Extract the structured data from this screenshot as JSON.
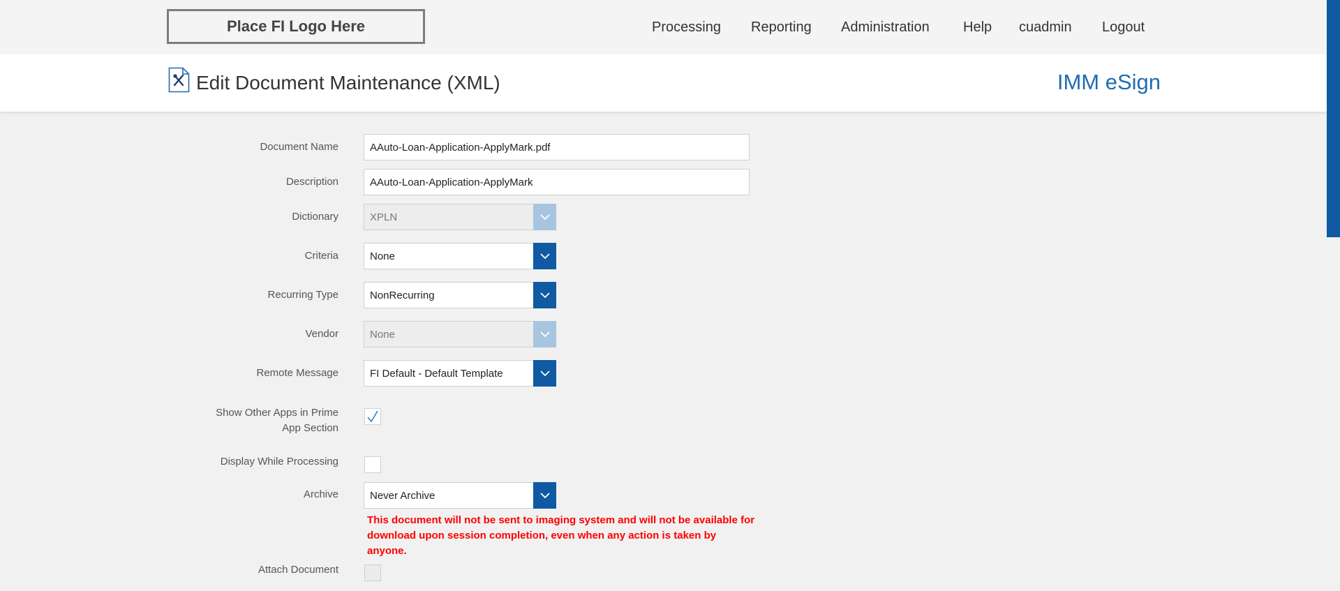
{
  "header": {
    "logo_text": "Place FI Logo Here",
    "nav": [
      {
        "label": "Processing"
      },
      {
        "label": "Reporting"
      },
      {
        "label": "Administration"
      },
      {
        "label": "Help"
      },
      {
        "label": "cuadmin"
      },
      {
        "label": "Logout"
      }
    ]
  },
  "title_bar": {
    "icon": "document-edit-icon",
    "title": "Edit Document Maintenance (XML)",
    "brand": "IMM eSign"
  },
  "form": {
    "document_name": {
      "label": "Document Name",
      "value": "AAuto-Loan-Application-ApplyMark.pdf"
    },
    "description": {
      "label": "Description",
      "value": "AAuto-Loan-Application-ApplyMark"
    },
    "dictionary": {
      "label": "Dictionary",
      "value": "XPLN",
      "disabled": true
    },
    "criteria": {
      "label": "Criteria",
      "value": "None"
    },
    "recurring_type": {
      "label": "Recurring Type",
      "value": "NonRecurring"
    },
    "vendor": {
      "label": "Vendor",
      "value": "None",
      "disabled": true
    },
    "remote_message": {
      "label": "Remote Message",
      "value": "FI Default - Default Template"
    },
    "show_other_apps": {
      "label": "Show Other Apps in Prime App Section",
      "checked": true
    },
    "display_while_processing": {
      "label": "Display While Processing",
      "checked": false
    },
    "archive": {
      "label": "Archive",
      "value": "Never Archive",
      "warning": "This document will not be sent to imaging system and will not be available for download upon session completion, even when any action is taken by anyone."
    },
    "attach_document": {
      "label": "Attach Document",
      "checked": false,
      "disabled": true
    }
  },
  "colors": {
    "accent": "#0f5aa3",
    "accent_disabled": "#a8c5e0",
    "brand": "#1f6bb3",
    "warning": "#ff0000",
    "check": "#2c7fc6"
  }
}
